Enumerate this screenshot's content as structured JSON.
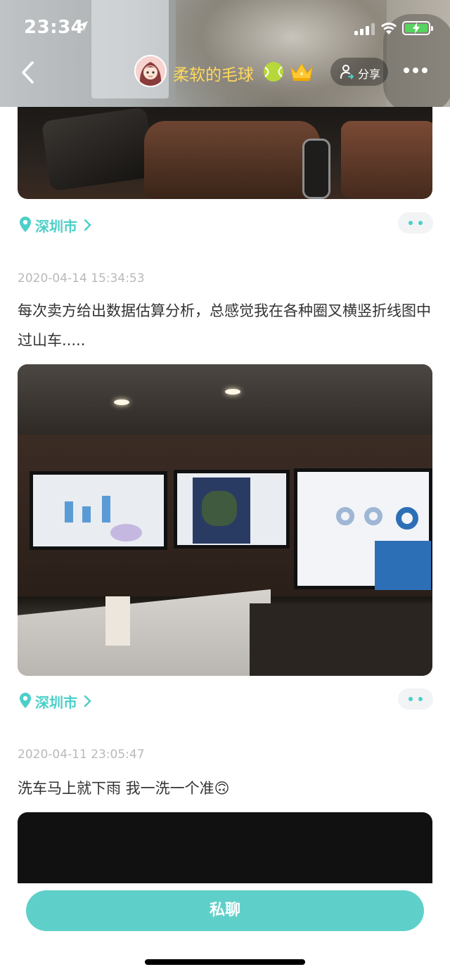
{
  "status_bar": {
    "time": "23:34"
  },
  "header": {
    "nickname": "柔软的毛球",
    "share_label": "分享",
    "icons": [
      "back-chevron-icon",
      "avatar",
      "tennis-ball-badge-icon",
      "crown-badge-icon",
      "share-user-icon",
      "more-dots-icon"
    ]
  },
  "posts": [
    {
      "location": "深圳市"
    },
    {
      "timestamp": "2020-04-14 15:34:53",
      "text": "每次卖方给出数据估算分析，总感觉我在各种圈叉横竖折线图中过山车.....",
      "location": "深圳市"
    },
    {
      "timestamp": "2020-04-11 23:05:47",
      "text": "洗车马上就下雨  我一洗一个准🙃"
    }
  ],
  "bottom_bar": {
    "private_chat_label": "私聊"
  },
  "colors": {
    "accent": "#4ccfc8",
    "chat_button": "#5fd0c9",
    "nickname": "#ffd95a",
    "timestamp": "#b9b9b9"
  }
}
